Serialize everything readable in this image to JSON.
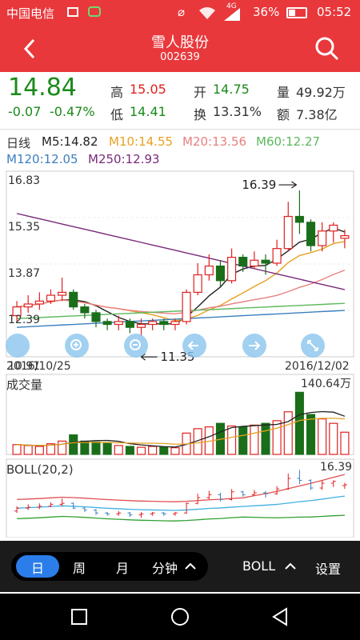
{
  "status": {
    "carrier": "中国电信",
    "network": "4G",
    "battery": "36%",
    "time": "05:52"
  },
  "header": {
    "title": "雪人股份",
    "code": "002639"
  },
  "quote": {
    "price": "14.84",
    "change": "-0.07",
    "change_pct": "-0.47%",
    "high_label": "高",
    "high": "15.05",
    "low_label": "低",
    "low": "14.41",
    "open_label": "开",
    "open": "14.75",
    "turnover_label": "换",
    "turnover": "13.31%",
    "volume_label": "量",
    "volume": "49.92万",
    "amount_label": "额",
    "amount": "7.38亿"
  },
  "ma": {
    "kline": "日线",
    "m5": "M5:14.82",
    "m10": "M10:14.55",
    "m20": "M20:13.56",
    "m60": "M60:12.27",
    "m120": "M120:12.05",
    "m250": "M250:12.93"
  },
  "colors": {
    "up": "#e02020",
    "down": "#1a6e1a",
    "m5": "#222222",
    "m10": "#e8a020",
    "m20": "#e88080",
    "m60": "#5cb85c",
    "m120": "#3a7fc0",
    "m250": "#7a2a7a",
    "accent": "#e8383c"
  },
  "chart_data": {
    "type": "candlestick",
    "y_ticks": [
      "16.83",
      "15.35",
      "13.87",
      "12.39",
      "10.91"
    ],
    "ylim": [
      10.91,
      16.83
    ],
    "date_start": "2016/10/25",
    "date_end": "2016/12/02",
    "high_label": "16.39",
    "low_label": "11.35",
    "candles": [
      [
        12.1,
        12.4,
        12.6,
        11.9
      ],
      [
        12.4,
        12.5,
        12.8,
        12.2
      ],
      [
        12.5,
        12.6,
        12.9,
        12.3
      ],
      [
        12.6,
        12.8,
        13.0,
        12.5
      ],
      [
        12.8,
        12.9,
        13.4,
        12.6
      ],
      [
        12.9,
        12.4,
        13.0,
        12.3
      ],
      [
        12.4,
        12.2,
        12.5,
        12.0
      ],
      [
        12.2,
        11.9,
        12.3,
        11.7
      ],
      [
        11.9,
        11.8,
        12.0,
        11.6
      ],
      [
        11.8,
        11.9,
        12.1,
        11.6
      ],
      [
        11.9,
        11.7,
        12.0,
        11.5
      ],
      [
        11.7,
        11.8,
        12.0,
        11.4
      ],
      [
        11.8,
        11.9,
        12.0,
        11.6
      ],
      [
        11.9,
        11.8,
        12.0,
        11.6
      ],
      [
        11.8,
        11.9,
        12.0,
        11.6
      ],
      [
        11.9,
        12.9,
        13.0,
        11.8
      ],
      [
        12.9,
        13.5,
        13.9,
        12.8
      ],
      [
        13.5,
        13.8,
        14.2,
        13.3
      ],
      [
        13.8,
        13.3,
        14.0,
        13.1
      ],
      [
        13.3,
        14.1,
        14.4,
        13.2
      ],
      [
        14.1,
        13.8,
        14.2,
        13.6
      ],
      [
        13.8,
        14.0,
        14.3,
        13.7
      ],
      [
        14.0,
        13.9,
        14.2,
        13.5
      ],
      [
        13.9,
        14.4,
        14.7,
        13.8
      ],
      [
        14.4,
        15.5,
        16.0,
        14.3
      ],
      [
        15.5,
        15.3,
        16.39,
        14.9
      ],
      [
        15.3,
        14.5,
        15.4,
        14.3
      ],
      [
        14.5,
        15.0,
        15.3,
        14.3
      ],
      [
        15.0,
        15.2,
        15.3,
        14.6
      ],
      [
        14.75,
        14.84,
        15.05,
        14.41
      ]
    ],
    "vol_title": "成交量",
    "vol_max_label": "140.64万",
    "volume": [
      22,
      20,
      18,
      24,
      30,
      44,
      30,
      28,
      25,
      20,
      18,
      16,
      18,
      16,
      15,
      48,
      58,
      62,
      70,
      64,
      62,
      66,
      70,
      76,
      96,
      140,
      90,
      80,
      70,
      50
    ],
    "boll_title": "BOLL(20,2)",
    "boll_high_label": "16.39"
  },
  "toolbar": {
    "day": "日",
    "week": "周",
    "month": "月",
    "minute": "分钟",
    "indicator": "BOLL",
    "settings": "设置"
  }
}
